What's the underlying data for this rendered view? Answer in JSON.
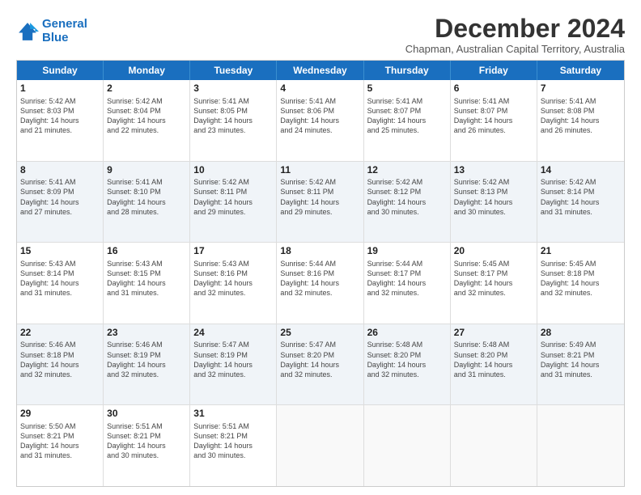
{
  "logo": {
    "line1": "General",
    "line2": "Blue"
  },
  "title": "December 2024",
  "subtitle": "Chapman, Australian Capital Territory, Australia",
  "header_days": [
    "Sunday",
    "Monday",
    "Tuesday",
    "Wednesday",
    "Thursday",
    "Friday",
    "Saturday"
  ],
  "weeks": [
    [
      {
        "num": "1",
        "sunrise": "Sunrise: 5:42 AM",
        "sunset": "Sunset: 8:03 PM",
        "daylight": "Daylight: 14 hours",
        "minutes": "and 21 minutes."
      },
      {
        "num": "2",
        "sunrise": "Sunrise: 5:42 AM",
        "sunset": "Sunset: 8:04 PM",
        "daylight": "Daylight: 14 hours",
        "minutes": "and 22 minutes."
      },
      {
        "num": "3",
        "sunrise": "Sunrise: 5:41 AM",
        "sunset": "Sunset: 8:05 PM",
        "daylight": "Daylight: 14 hours",
        "minutes": "and 23 minutes."
      },
      {
        "num": "4",
        "sunrise": "Sunrise: 5:41 AM",
        "sunset": "Sunset: 8:06 PM",
        "daylight": "Daylight: 14 hours",
        "minutes": "and 24 minutes."
      },
      {
        "num": "5",
        "sunrise": "Sunrise: 5:41 AM",
        "sunset": "Sunset: 8:07 PM",
        "daylight": "Daylight: 14 hours",
        "minutes": "and 25 minutes."
      },
      {
        "num": "6",
        "sunrise": "Sunrise: 5:41 AM",
        "sunset": "Sunset: 8:07 PM",
        "daylight": "Daylight: 14 hours",
        "minutes": "and 26 minutes."
      },
      {
        "num": "7",
        "sunrise": "Sunrise: 5:41 AM",
        "sunset": "Sunset: 8:08 PM",
        "daylight": "Daylight: 14 hours",
        "minutes": "and 26 minutes."
      }
    ],
    [
      {
        "num": "8",
        "sunrise": "Sunrise: 5:41 AM",
        "sunset": "Sunset: 8:09 PM",
        "daylight": "Daylight: 14 hours",
        "minutes": "and 27 minutes."
      },
      {
        "num": "9",
        "sunrise": "Sunrise: 5:41 AM",
        "sunset": "Sunset: 8:10 PM",
        "daylight": "Daylight: 14 hours",
        "minutes": "and 28 minutes."
      },
      {
        "num": "10",
        "sunrise": "Sunrise: 5:42 AM",
        "sunset": "Sunset: 8:11 PM",
        "daylight": "Daylight: 14 hours",
        "minutes": "and 29 minutes."
      },
      {
        "num": "11",
        "sunrise": "Sunrise: 5:42 AM",
        "sunset": "Sunset: 8:11 PM",
        "daylight": "Daylight: 14 hours",
        "minutes": "and 29 minutes."
      },
      {
        "num": "12",
        "sunrise": "Sunrise: 5:42 AM",
        "sunset": "Sunset: 8:12 PM",
        "daylight": "Daylight: 14 hours",
        "minutes": "and 30 minutes."
      },
      {
        "num": "13",
        "sunrise": "Sunrise: 5:42 AM",
        "sunset": "Sunset: 8:13 PM",
        "daylight": "Daylight: 14 hours",
        "minutes": "and 30 minutes."
      },
      {
        "num": "14",
        "sunrise": "Sunrise: 5:42 AM",
        "sunset": "Sunset: 8:14 PM",
        "daylight": "Daylight: 14 hours",
        "minutes": "and 31 minutes."
      }
    ],
    [
      {
        "num": "15",
        "sunrise": "Sunrise: 5:43 AM",
        "sunset": "Sunset: 8:14 PM",
        "daylight": "Daylight: 14 hours",
        "minutes": "and 31 minutes."
      },
      {
        "num": "16",
        "sunrise": "Sunrise: 5:43 AM",
        "sunset": "Sunset: 8:15 PM",
        "daylight": "Daylight: 14 hours",
        "minutes": "and 31 minutes."
      },
      {
        "num": "17",
        "sunrise": "Sunrise: 5:43 AM",
        "sunset": "Sunset: 8:16 PM",
        "daylight": "Daylight: 14 hours",
        "minutes": "and 32 minutes."
      },
      {
        "num": "18",
        "sunrise": "Sunrise: 5:44 AM",
        "sunset": "Sunset: 8:16 PM",
        "daylight": "Daylight: 14 hours",
        "minutes": "and 32 minutes."
      },
      {
        "num": "19",
        "sunrise": "Sunrise: 5:44 AM",
        "sunset": "Sunset: 8:17 PM",
        "daylight": "Daylight: 14 hours",
        "minutes": "and 32 minutes."
      },
      {
        "num": "20",
        "sunrise": "Sunrise: 5:45 AM",
        "sunset": "Sunset: 8:17 PM",
        "daylight": "Daylight: 14 hours",
        "minutes": "and 32 minutes."
      },
      {
        "num": "21",
        "sunrise": "Sunrise: 5:45 AM",
        "sunset": "Sunset: 8:18 PM",
        "daylight": "Daylight: 14 hours",
        "minutes": "and 32 minutes."
      }
    ],
    [
      {
        "num": "22",
        "sunrise": "Sunrise: 5:46 AM",
        "sunset": "Sunset: 8:18 PM",
        "daylight": "Daylight: 14 hours",
        "minutes": "and 32 minutes."
      },
      {
        "num": "23",
        "sunrise": "Sunrise: 5:46 AM",
        "sunset": "Sunset: 8:19 PM",
        "daylight": "Daylight: 14 hours",
        "minutes": "and 32 minutes."
      },
      {
        "num": "24",
        "sunrise": "Sunrise: 5:47 AM",
        "sunset": "Sunset: 8:19 PM",
        "daylight": "Daylight: 14 hours",
        "minutes": "and 32 minutes."
      },
      {
        "num": "25",
        "sunrise": "Sunrise: 5:47 AM",
        "sunset": "Sunset: 8:20 PM",
        "daylight": "Daylight: 14 hours",
        "minutes": "and 32 minutes."
      },
      {
        "num": "26",
        "sunrise": "Sunrise: 5:48 AM",
        "sunset": "Sunset: 8:20 PM",
        "daylight": "Daylight: 14 hours",
        "minutes": "and 32 minutes."
      },
      {
        "num": "27",
        "sunrise": "Sunrise: 5:48 AM",
        "sunset": "Sunset: 8:20 PM",
        "daylight": "Daylight: 14 hours",
        "minutes": "and 31 minutes."
      },
      {
        "num": "28",
        "sunrise": "Sunrise: 5:49 AM",
        "sunset": "Sunset: 8:21 PM",
        "daylight": "Daylight: 14 hours",
        "minutes": "and 31 minutes."
      }
    ],
    [
      {
        "num": "29",
        "sunrise": "Sunrise: 5:50 AM",
        "sunset": "Sunset: 8:21 PM",
        "daylight": "Daylight: 14 hours",
        "minutes": "and 31 minutes."
      },
      {
        "num": "30",
        "sunrise": "Sunrise: 5:51 AM",
        "sunset": "Sunset: 8:21 PM",
        "daylight": "Daylight: 14 hours",
        "minutes": "and 30 minutes."
      },
      {
        "num": "31",
        "sunrise": "Sunrise: 5:51 AM",
        "sunset": "Sunset: 8:21 PM",
        "daylight": "Daylight: 14 hours",
        "minutes": "and 30 minutes."
      },
      {
        "num": "",
        "sunrise": "",
        "sunset": "",
        "daylight": "",
        "minutes": ""
      },
      {
        "num": "",
        "sunrise": "",
        "sunset": "",
        "daylight": "",
        "minutes": ""
      },
      {
        "num": "",
        "sunrise": "",
        "sunset": "",
        "daylight": "",
        "minutes": ""
      },
      {
        "num": "",
        "sunrise": "",
        "sunset": "",
        "daylight": "",
        "minutes": ""
      }
    ]
  ],
  "colors": {
    "header_bg": "#1a6fbf",
    "row_shade": "#eef3f8"
  }
}
